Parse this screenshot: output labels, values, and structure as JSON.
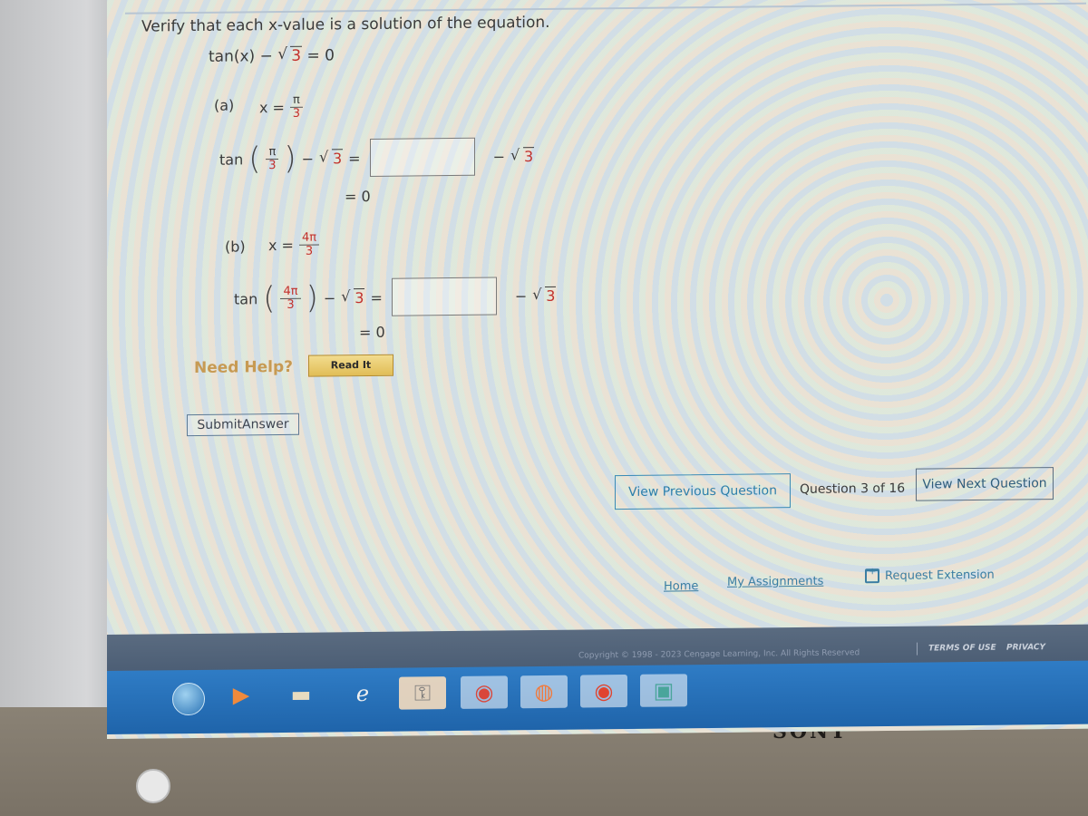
{
  "question": {
    "prompt": "Verify that each x-value is a solution of the equation.",
    "equation": {
      "left": "tan(x) − ",
      "radicand": "3",
      "right": " = 0"
    },
    "parts": [
      {
        "label": "(a)",
        "x_prefix": "x =",
        "x_numerator": "π",
        "x_denominator": "3",
        "func": "tan",
        "arg_numerator": "π",
        "arg_denominator": "3",
        "minus": "−",
        "radicand": "3",
        "equals": "=",
        "answer_value": "",
        "after_box_minus": "−",
        "after_box_radicand": "3",
        "result": "= 0"
      },
      {
        "label": "(b)",
        "x_prefix": "x =",
        "x_numerator": "4π",
        "x_denominator": "3",
        "func": "tan",
        "arg_numerator": "4π",
        "arg_denominator": "3",
        "minus": "−",
        "radicand": "3",
        "equals": "=",
        "answer_value": "",
        "after_box_minus": "−",
        "after_box_radicand": "3",
        "result": "= 0"
      }
    ]
  },
  "help": {
    "label": "Need Help?",
    "read_it": "Read It"
  },
  "submit_label": "SubmitAnswer",
  "navigation": {
    "previous": "View Previous Question",
    "counter": "Question 3 of 16",
    "next": "View Next Question"
  },
  "footer": {
    "home": "Home",
    "my_assignments": "My Assignments",
    "request_extension": "Request Extension",
    "copyright": "Copyright © 1998 - 2023 Cengage Learning, Inc. All Rights Reserved",
    "terms": "TERMS OF USE",
    "privacy": "PRIVACY"
  },
  "taskbar": {
    "items": [
      "start-orb",
      "media-player",
      "file-explorer",
      "internet-explorer",
      "app",
      "chrome",
      "firefox",
      "chrome-canary",
      "window"
    ]
  },
  "device": {
    "brand": "SONY"
  },
  "colors": {
    "accent_red": "#c2302b",
    "link_blue": "#3b7ea3",
    "help_gold": "#c79a53"
  }
}
